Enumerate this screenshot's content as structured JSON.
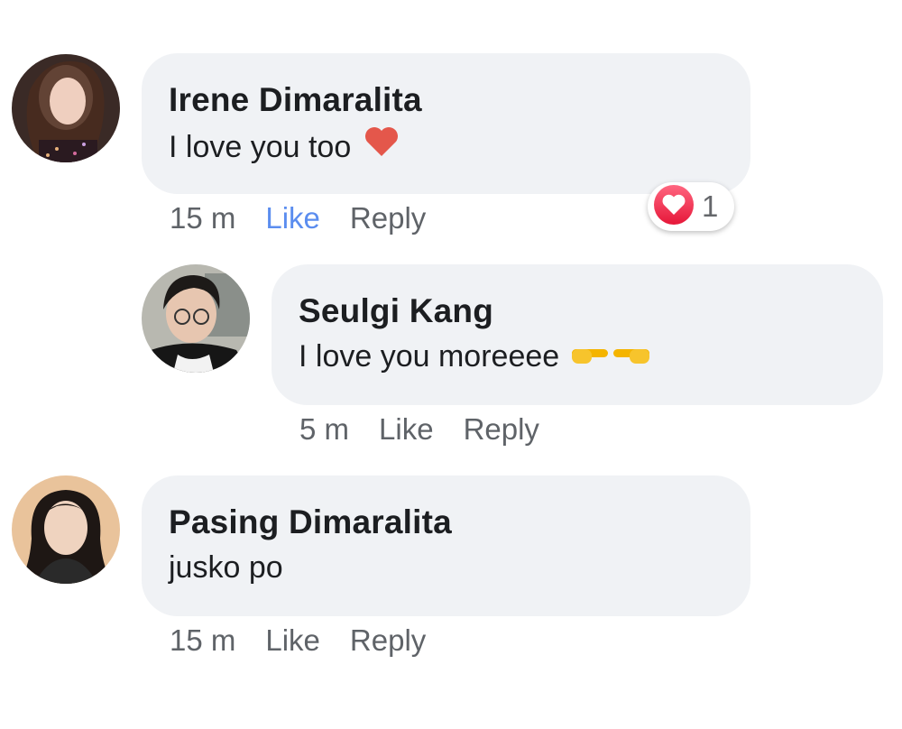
{
  "comments": [
    {
      "author": "Irene Dimaralita",
      "text": "I love you too",
      "time": "15 m",
      "like_label": "Like",
      "reply_label": "Reply",
      "liked": true,
      "reaction_count": "1",
      "colors": {
        "link_active": "#5b8def",
        "heart": "#e4574b"
      }
    },
    {
      "author": "Seulgi Kang",
      "text": "I love you moreeee",
      "time": "5 m",
      "like_label": "Like",
      "reply_label": "Reply",
      "liked": false
    },
    {
      "author": "Pasing Dimaralita",
      "text": "jusko po",
      "time": "15 m",
      "like_label": "Like",
      "reply_label": "Reply",
      "liked": false
    }
  ],
  "icons": [
    "heart-emoji-icon",
    "pointing-right-emoji-icon",
    "pointing-left-emoji-icon",
    "love-reaction-icon"
  ],
  "colors": {
    "bubble_bg": "#f0f2f5",
    "meta_text": "#5f6368",
    "name_text": "#1c1e21"
  }
}
